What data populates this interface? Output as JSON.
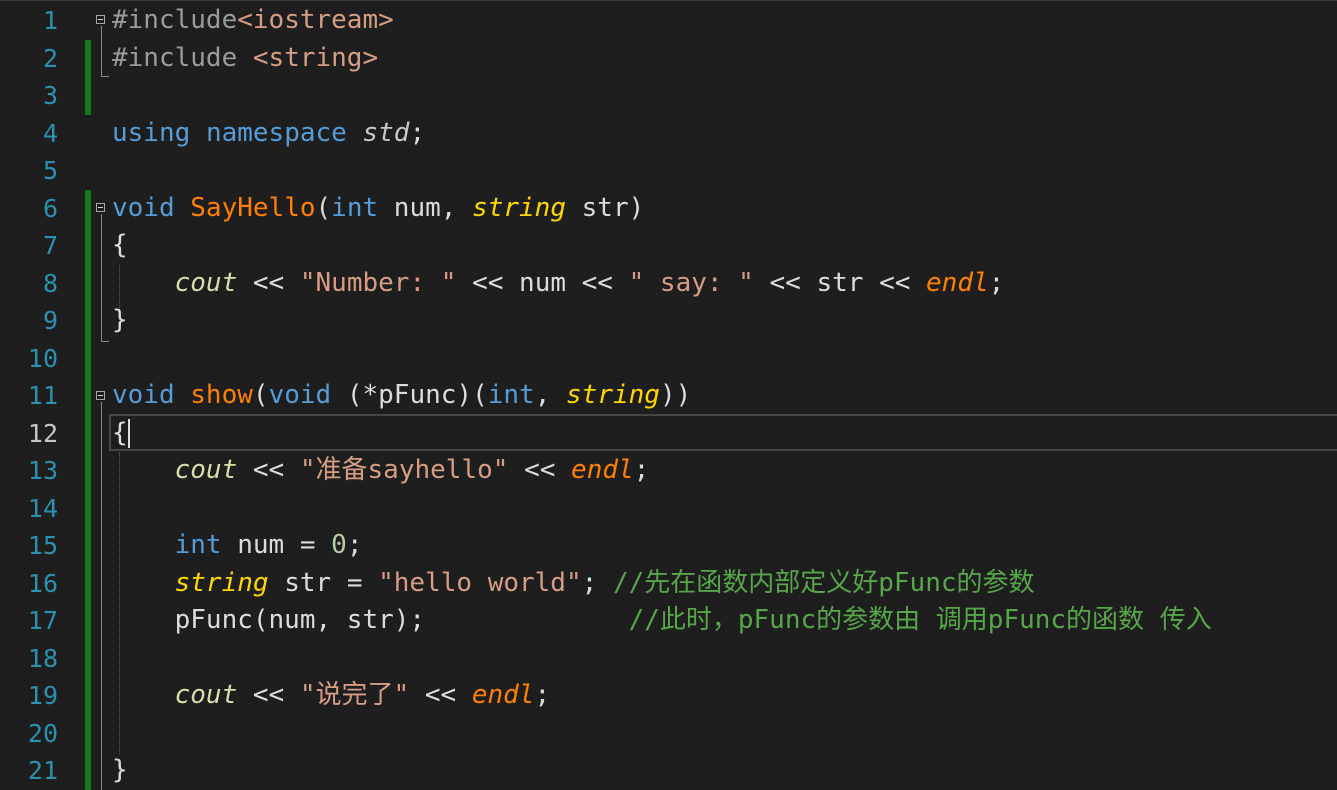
{
  "editor": {
    "current_line": 12,
    "gutter": [
      "1",
      "2",
      "3",
      "4",
      "5",
      "6",
      "7",
      "8",
      "9",
      "10",
      "11",
      "12",
      "13",
      "14",
      "15",
      "16",
      "17",
      "18",
      "19",
      "20",
      "21"
    ],
    "lines": {
      "l1": [
        {
          "t": "#include",
          "c": "pp"
        },
        {
          "t": "<iostream>",
          "c": "inc"
        }
      ],
      "l2": [
        {
          "t": "#include ",
          "c": "pp"
        },
        {
          "t": "<string>",
          "c": "inc"
        }
      ],
      "l3": [],
      "l4": [
        {
          "t": "using",
          "c": "kw"
        },
        {
          "t": " ",
          "c": "pl"
        },
        {
          "t": "namespace",
          "c": "kw"
        },
        {
          "t": " ",
          "c": "pl"
        },
        {
          "t": "std",
          "c": "ns"
        },
        {
          "t": ";",
          "c": "pl"
        }
      ],
      "l5": [],
      "l6": [
        {
          "t": "void",
          "c": "kw"
        },
        {
          "t": " ",
          "c": "pl"
        },
        {
          "t": "SayHello",
          "c": "fn"
        },
        {
          "t": "(",
          "c": "pl"
        },
        {
          "t": "int",
          "c": "kw"
        },
        {
          "t": " num, ",
          "c": "pl"
        },
        {
          "t": "string",
          "c": "ty-str"
        },
        {
          "t": " str)",
          "c": "pl"
        }
      ],
      "l7": [
        {
          "t": "{",
          "c": "pl"
        }
      ],
      "l8": [
        {
          "t": "    ",
          "c": "pl"
        },
        {
          "t": "cout",
          "c": "obj"
        },
        {
          "t": " << ",
          "c": "pl"
        },
        {
          "t": "\"Number: \"",
          "c": "str"
        },
        {
          "t": " << num << ",
          "c": "pl"
        },
        {
          "t": "\" say: \"",
          "c": "str"
        },
        {
          "t": " << str << ",
          "c": "pl"
        },
        {
          "t": "endl",
          "c": "endl"
        },
        {
          "t": ";",
          "c": "pl"
        }
      ],
      "l9": [
        {
          "t": "}",
          "c": "pl"
        }
      ],
      "l10": [],
      "l11": [
        {
          "t": "void",
          "c": "kw"
        },
        {
          "t": " ",
          "c": "pl"
        },
        {
          "t": "show",
          "c": "fn"
        },
        {
          "t": "(",
          "c": "pl"
        },
        {
          "t": "void",
          "c": "kw"
        },
        {
          "t": " (*pFunc)(",
          "c": "pl"
        },
        {
          "t": "int",
          "c": "kw"
        },
        {
          "t": ", ",
          "c": "pl"
        },
        {
          "t": "string",
          "c": "ty-str"
        },
        {
          "t": "))",
          "c": "pl"
        }
      ],
      "l12": [
        {
          "t": "{",
          "c": "pl"
        }
      ],
      "l13": [
        {
          "t": "    ",
          "c": "pl"
        },
        {
          "t": "cout",
          "c": "obj"
        },
        {
          "t": " << ",
          "c": "pl"
        },
        {
          "t": "\"准备sayhello\"",
          "c": "str"
        },
        {
          "t": " << ",
          "c": "pl"
        },
        {
          "t": "endl",
          "c": "endl"
        },
        {
          "t": ";",
          "c": "pl"
        }
      ],
      "l14": [],
      "l15": [
        {
          "t": "    ",
          "c": "pl"
        },
        {
          "t": "int",
          "c": "kw"
        },
        {
          "t": " num = ",
          "c": "pl"
        },
        {
          "t": "0",
          "c": "num"
        },
        {
          "t": ";",
          "c": "pl"
        }
      ],
      "l16": [
        {
          "t": "    ",
          "c": "pl"
        },
        {
          "t": "string",
          "c": "ty-str"
        },
        {
          "t": " str = ",
          "c": "pl"
        },
        {
          "t": "\"hello world\"",
          "c": "str"
        },
        {
          "t": "; ",
          "c": "pl"
        },
        {
          "t": "//先在函数内部定义好pFunc的参数",
          "c": "cmt"
        }
      ],
      "l17": [
        {
          "t": "    pFunc(num, str);             ",
          "c": "pfn"
        },
        {
          "t": "//此时，pFunc的参数由 调用pFunc的函数 传入",
          "c": "cmt"
        }
      ],
      "l18": [],
      "l19": [
        {
          "t": "    ",
          "c": "pl"
        },
        {
          "t": "cout",
          "c": "obj"
        },
        {
          "t": " << ",
          "c": "pl"
        },
        {
          "t": "\"说完了\"",
          "c": "str"
        },
        {
          "t": " << ",
          "c": "pl"
        },
        {
          "t": "endl",
          "c": "endl"
        },
        {
          "t": ";",
          "c": "pl"
        }
      ],
      "l20": [],
      "l21": [
        {
          "t": "}",
          "c": "pl"
        }
      ]
    }
  },
  "colors": {
    "background": "#1e1e1e",
    "keyword": "#569cd6",
    "function": "#ff8000",
    "string": "#d69d85",
    "comment": "#57a64a",
    "line_number": "#2b91af",
    "change_bar": "#13781c"
  },
  "icons": [
    "fold-collapse-icon"
  ]
}
